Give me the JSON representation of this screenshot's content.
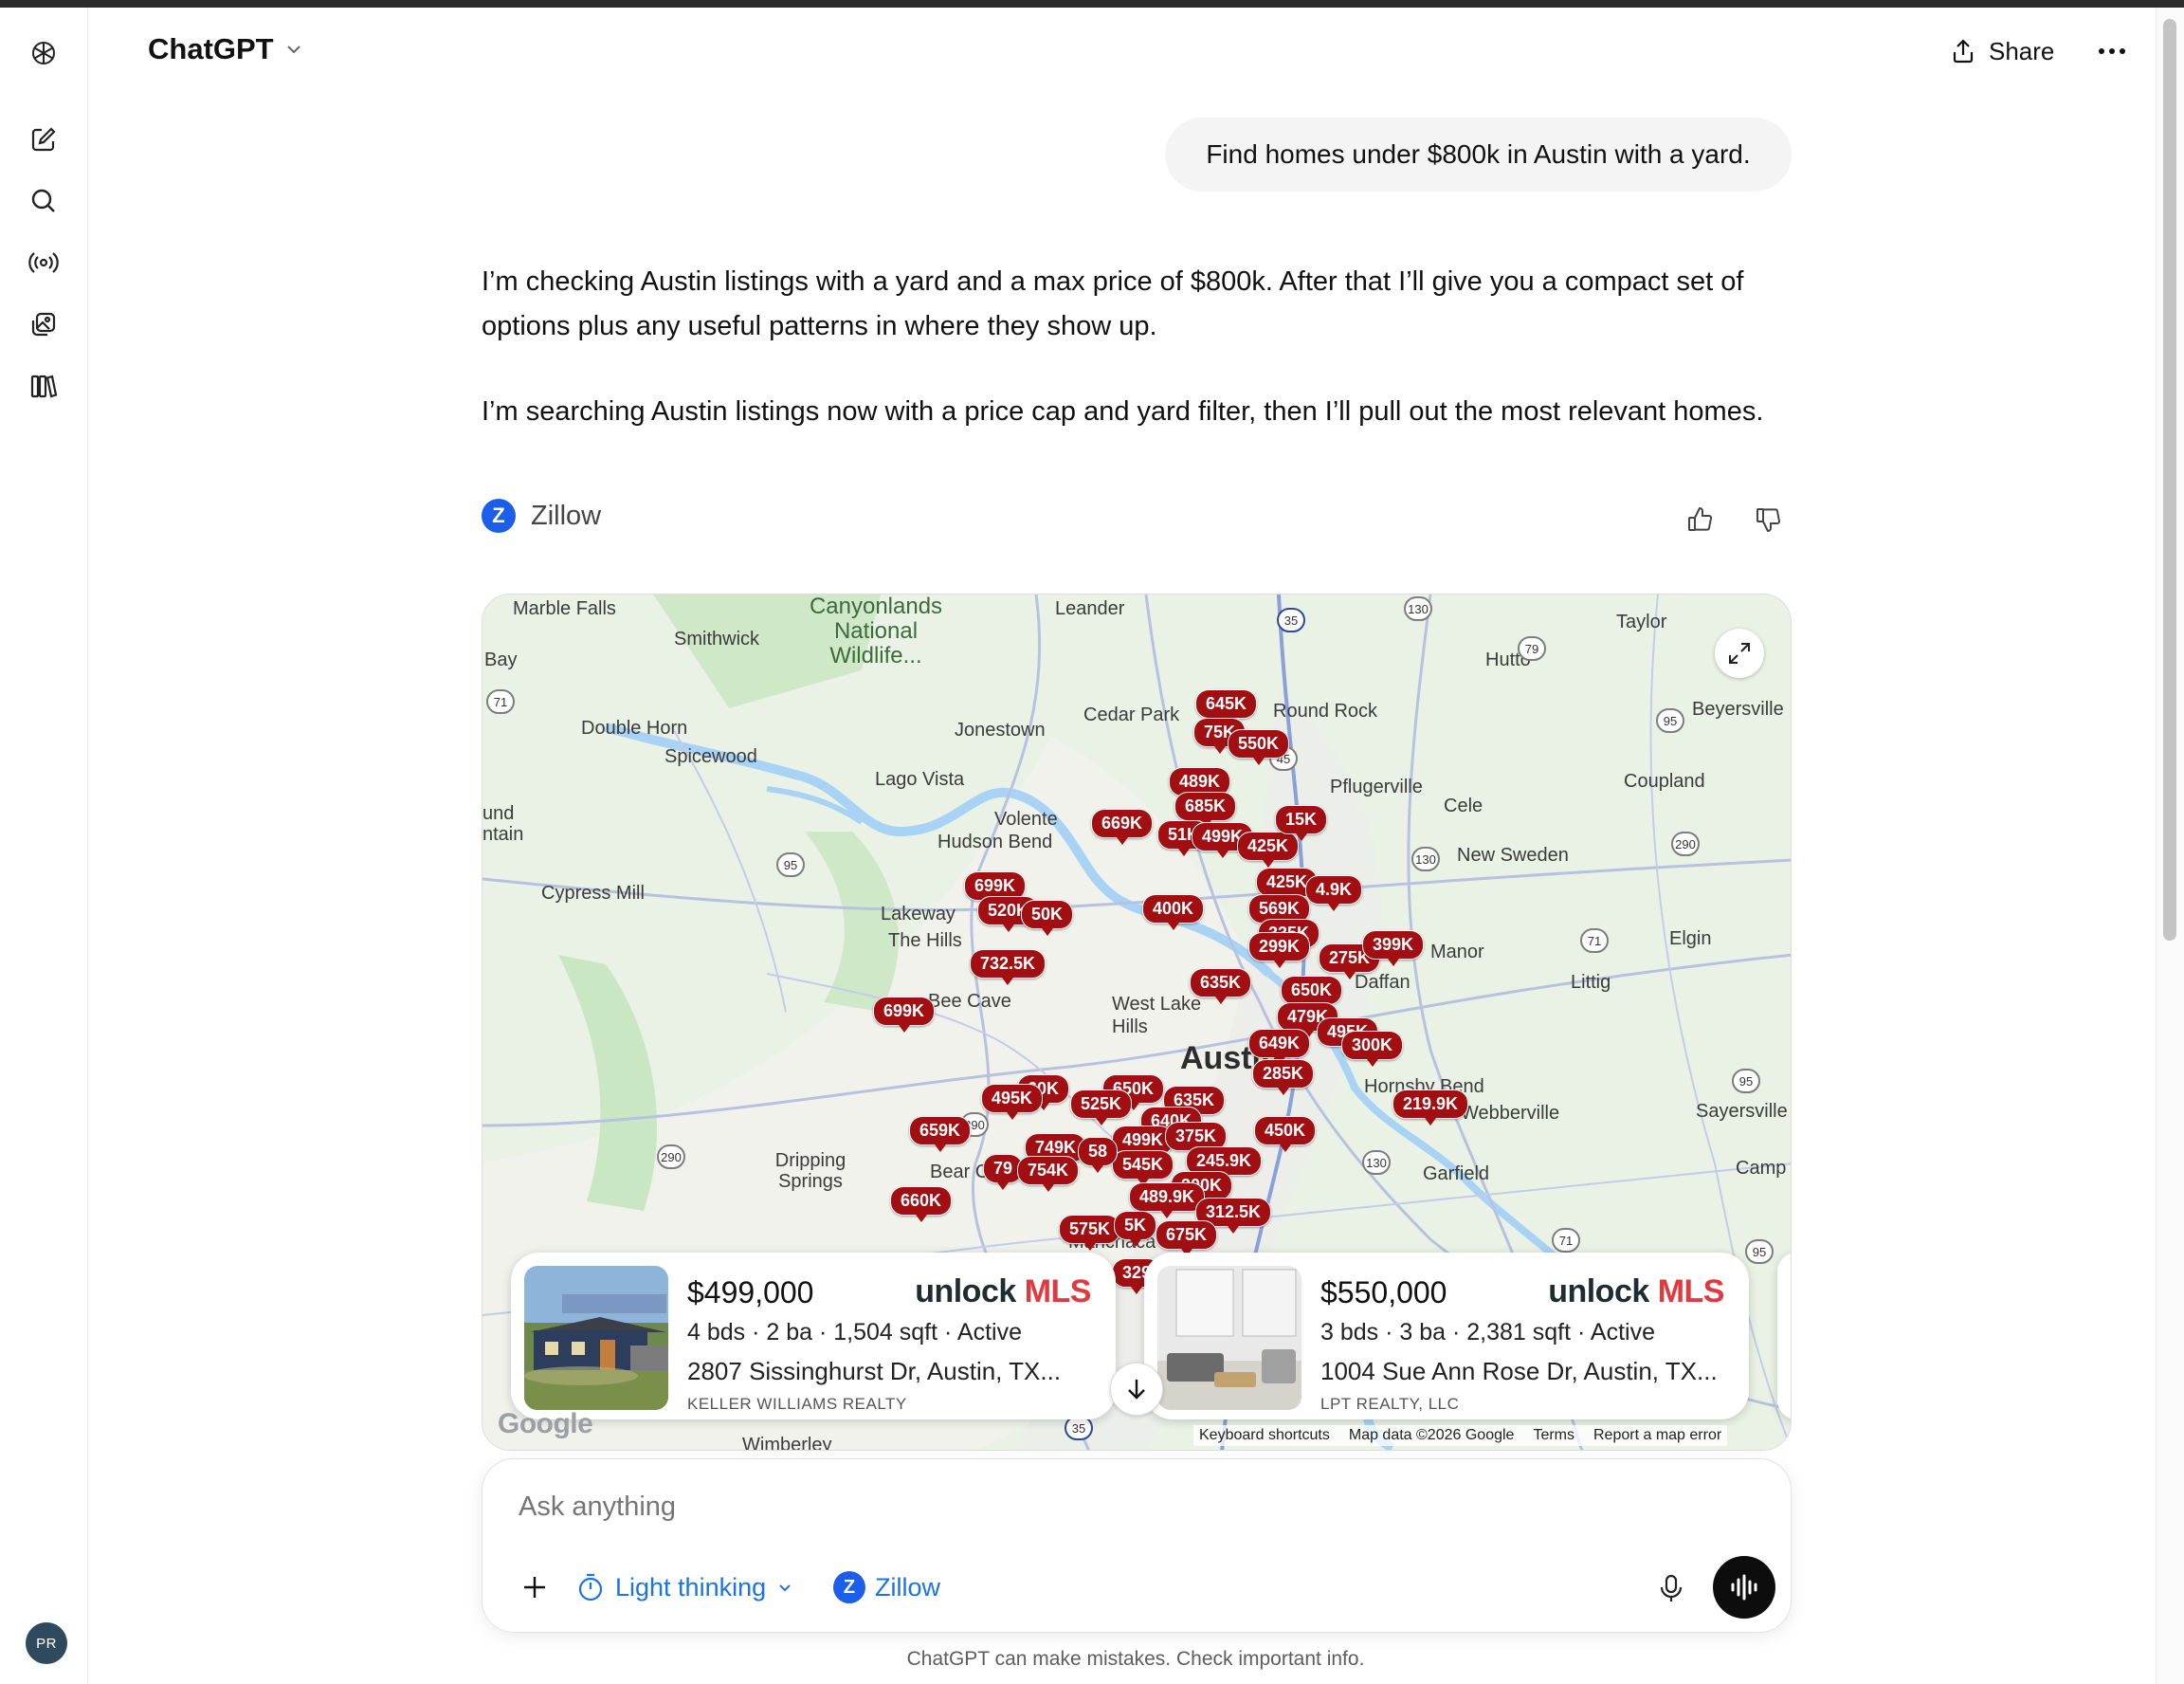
{
  "header": {
    "model_name": "ChatGPT",
    "share_label": "Share"
  },
  "sidebar": {
    "avatar_initials": "PR",
    "icons": [
      "openai-logo-icon",
      "new-chat-icon",
      "search-icon",
      "broadcast-icon",
      "gallery-icon",
      "library-icon"
    ]
  },
  "conversation": {
    "user_message": "Find homes under $800k in Austin with a yard.",
    "assistant_paragraphs": [
      "I’m checking Austin listings with a yard and a max price of $800k. After that I’ll give you a compact set of options plus any useful patterns in where they show up.",
      "I’m searching Austin listings now with a price cap and yard filter, then I’ll pull out the most relevant homes."
    ],
    "source_name": "Zillow"
  },
  "map": {
    "places": [
      "Marble Falls",
      "Canyonlands National Wildlife...",
      "Leander",
      "Taylor",
      "Smithwick",
      "Hutto",
      "Bay",
      "Double Horn",
      "Jonestown",
      "Cedar Park",
      "Round Rock",
      "Beyersville",
      "Spicewood",
      "Lago Vista",
      "Pflugerville",
      "Cele",
      "Coupland",
      "Volente",
      "Hudson Bend",
      "New Sweden",
      "Cypress Mill",
      "Lakeway",
      "The Hills",
      "Manor",
      "Elgin",
      "Bee Cave",
      "West Lake Hills",
      "Littig",
      "Austin",
      "Hornsby Bend",
      "Webberville",
      "Sayersville",
      "Dripping Springs",
      "Bear Creek",
      "Garfield",
      "Camp",
      "Wimberley",
      "und ntain",
      "Manchaca",
      "Daffan"
    ],
    "price_pins": [
      "645K",
      "75K",
      "550K",
      "489K",
      "685K",
      "669K",
      "51K",
      "499K",
      "425K",
      "15K",
      "699K",
      "520K",
      "50K",
      "400K",
      "425K",
      "4.9K",
      "569K",
      "335K",
      "299K",
      "275K",
      "399K",
      "732.5K",
      "635K",
      "650K",
      "699K",
      "479K",
      "495K",
      "649K",
      "300K",
      "285K",
      "60K",
      "650K",
      "495K",
      "525K",
      "635K",
      "219.9K",
      "659K",
      "640K",
      "499K",
      "375K",
      "450K",
      "749K",
      "545K",
      "245.9K",
      "79",
      "754K",
      "58",
      "300K",
      "660K",
      "489.9K",
      "312.5K",
      "575K",
      "5K",
      "675K",
      "329"
    ],
    "attribution": {
      "google": "Google",
      "shortcuts": "Keyboard shortcuts",
      "map_data": "Map data ©2026 Google",
      "terms": "Terms",
      "report": "Report a map error"
    },
    "road_labels": [
      "130",
      "35",
      "79",
      "71",
      "95",
      "45",
      "130",
      "95",
      "71",
      "290",
      "290",
      "95",
      "130",
      "71",
      "95",
      "35",
      "290"
    ]
  },
  "listings": [
    {
      "price": "$499,000",
      "stats": "4 bds · 2 ba · 1,504 sqft · Active",
      "address": "2807 Sissinghurst Dr, Austin, TX...",
      "broker": "KELLER WILLIAMS REALTY",
      "badge_word1": "unlock",
      "badge_word2": "MLS"
    },
    {
      "price": "$550,000",
      "stats": "3 bds · 3 ba · 2,381 sqft · Active",
      "address": "1004 Sue Ann Rose Dr, Austin, TX...",
      "broker": "LPT REALTY, LLC",
      "badge_word1": "unlock",
      "badge_word2": "MLS"
    }
  ],
  "composer": {
    "placeholder": "Ask anything",
    "thinking_label": "Light thinking",
    "tool_label": "Zillow"
  },
  "footer": {
    "disclaimer": "ChatGPT can make mistakes. Check important info."
  }
}
